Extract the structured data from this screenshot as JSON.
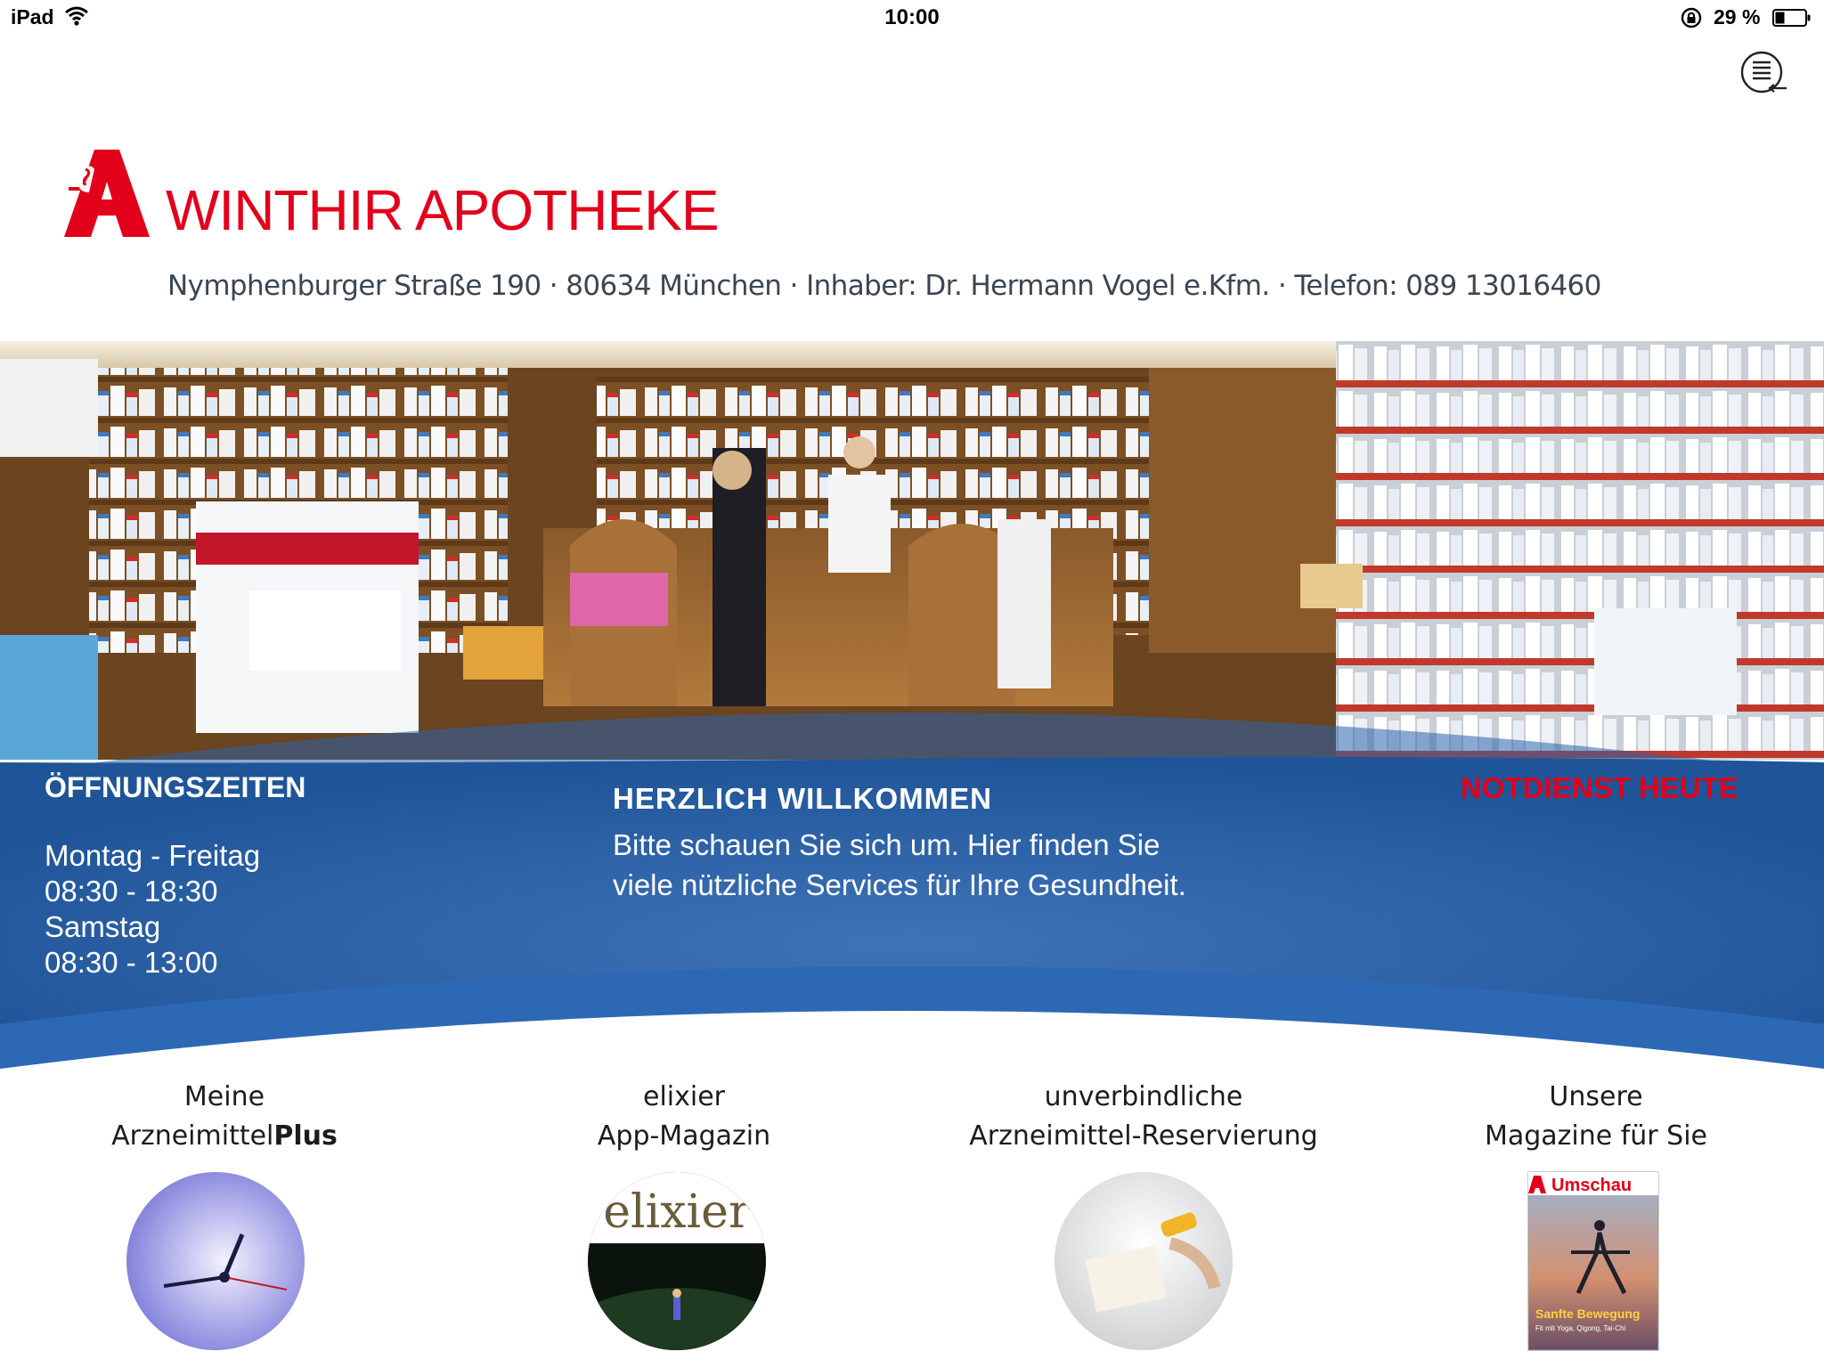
{
  "status_bar": {
    "device": "iPad",
    "time": "10:00",
    "battery_percent": "29 %",
    "icons": [
      "wifi-icon",
      "orientation-lock-icon",
      "battery-icon"
    ]
  },
  "header": {
    "menu_icon": "list-menu-icon",
    "logo_icon": "apotheke-a-logo",
    "brand": "WINTHIR APOTHEKE",
    "address": "Nymphenburger Straße 190 · 80634 München · Inhaber: Dr. Hermann Vogel e.Kfm. · Telefon: 089 13016460"
  },
  "colors": {
    "brand_red": "#e3001b",
    "band_blue": "#1f5598",
    "band_light_blue": "#3f73b8"
  },
  "opening_hours": {
    "title": "ÖFFNUNGSZEITEN",
    "lines": [
      "Montag - Freitag",
      "08:30 - 18:30",
      "Samstag",
      "08:30 - 13:00"
    ]
  },
  "welcome": {
    "title": "HERZLICH WILLKOMMEN",
    "lines": [
      "Bitte schauen Sie sich um. Hier finden Sie",
      "viele nützliche Services für Ihre Gesundheit."
    ]
  },
  "notdienst": {
    "label": "NOTDIENST HEUTE"
  },
  "tiles": [
    {
      "line1": "Meine",
      "line2_prefix": "Arzneimittel",
      "line2_bold": "Plus",
      "image": "clock"
    },
    {
      "line1": "elixier",
      "line2": "App-Magazin",
      "image": "elixier-magazine",
      "image_text": "elixier"
    },
    {
      "line1": "unverbindliche",
      "line2": "Arzneimittel-Reservierung",
      "image": "pharmacist-hand"
    },
    {
      "line1": "Unsere",
      "line2": "Magazine für Sie",
      "image": "umschau-cover",
      "cover_title": "Umschau",
      "cover_headline": "Sanfte Bewegung",
      "cover_sub": "Fit mit Yoga, Qigong, Tai-Chi"
    }
  ]
}
